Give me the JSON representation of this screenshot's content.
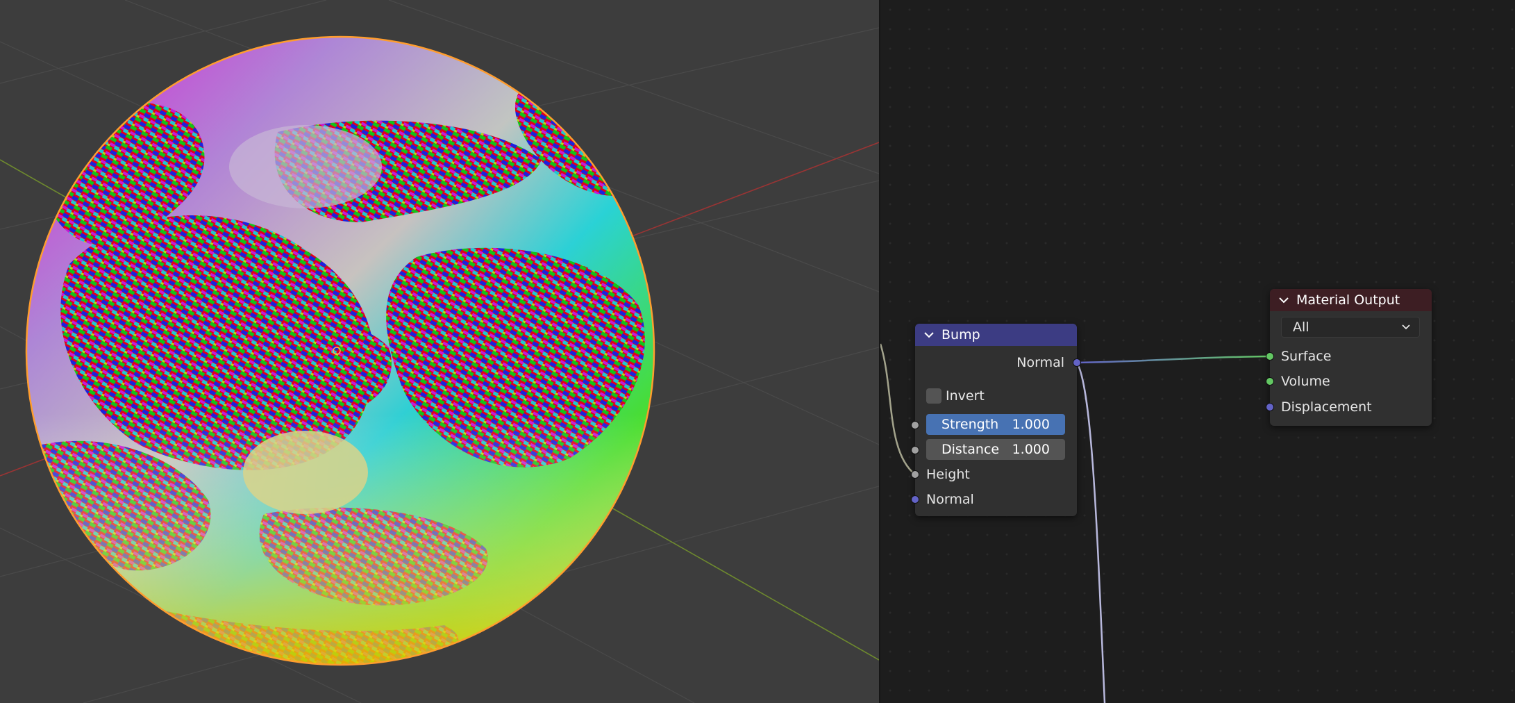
{
  "bump_node": {
    "title": "Bump",
    "output_normal": "Normal",
    "invert_label": "Invert",
    "strength_label": "Strength",
    "strength_value": "1.000",
    "distance_label": "Distance",
    "distance_value": "1.000",
    "input_height": "Height",
    "input_normal": "Normal",
    "header_color": "#3c3c83",
    "strength_color": "#4772b3"
  },
  "material_output_node": {
    "title": "Material Output",
    "target_selected": "All",
    "input_surface": "Surface",
    "input_volume": "Volume",
    "input_displacement": "Displacement",
    "header_color": "#3d1e23"
  },
  "socket_colors": {
    "shader": "#63c763",
    "vector": "#6363c7",
    "float": "#a1a1a1"
  }
}
